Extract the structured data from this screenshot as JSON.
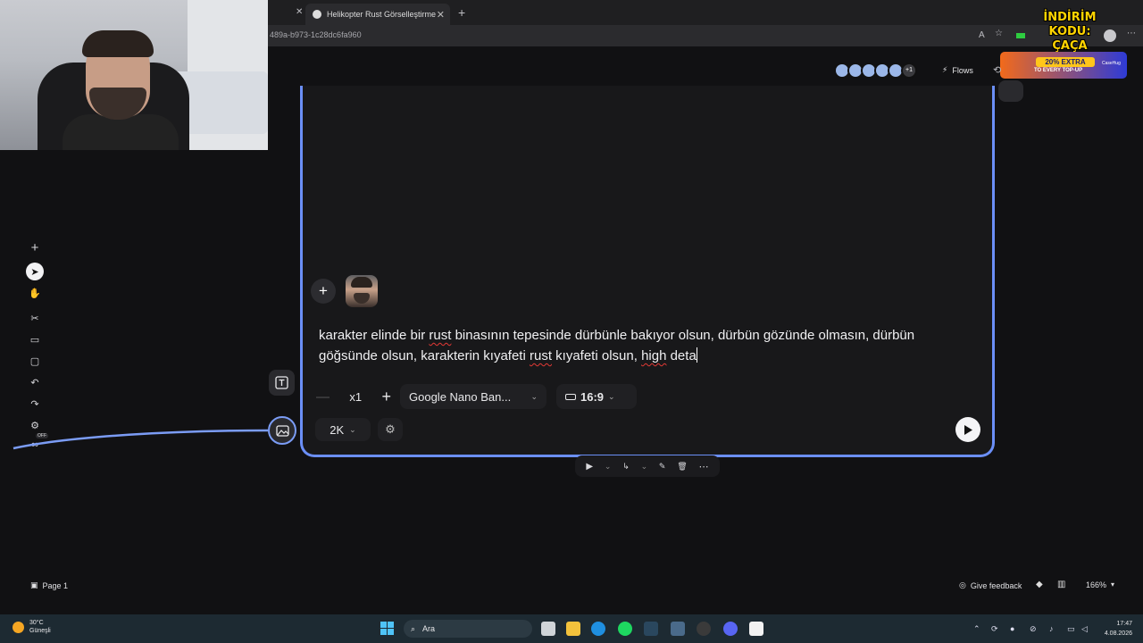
{
  "browser": {
    "tab_title": "Helikopter Rust Görselleştirme",
    "url": "489a-b973-1c28dc6fa960"
  },
  "promo": {
    "code_line1": "İNDİRİM KODU:",
    "code_line2": "ÇAÇA",
    "banner": "20% EXTRA",
    "banner_sub": "TO EVERY TOP-UP",
    "brand": "CaseHug"
  },
  "header": {
    "collaborators_more": "+1",
    "flows_label": "Flows"
  },
  "toolbar": {
    "off_badge": "OFF"
  },
  "node": {
    "prompt_parts": {
      "p1": "karakter elinde bir ",
      "w1": "rust",
      "p2": " binasının tepesinde dürbünle bakıyor olsun, dürbün gözünde olmasın, dürbün göğsünde olsun, karakterin kıyafeti ",
      "w2": "rust",
      "p3": " kıyafeti olsun, ",
      "w3": "high",
      "p4": " deta"
    },
    "quantity": "x1",
    "model": "Google Nano Ban...",
    "aspect_ratio": "16:9",
    "resolution": "2K"
  },
  "footer": {
    "page_tab": "Page 1",
    "feedback": "Give feedback",
    "zoom": "166%"
  },
  "taskbar": {
    "temperature": "30°C",
    "weather": "Güneşli",
    "search_placeholder": "Ara",
    "time": "17:47",
    "date": "4.08.2026"
  },
  "colors": {
    "accent": "#6b8ff7",
    "background": "#111113",
    "node_bg": "#18181a",
    "spellcheck": "#e53935"
  }
}
